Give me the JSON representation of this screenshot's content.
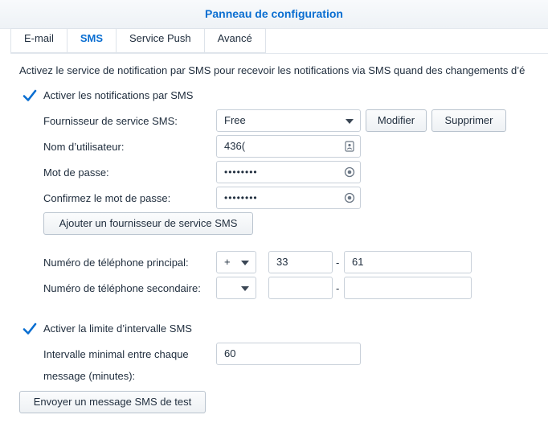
{
  "header": {
    "title": "Panneau de configuration"
  },
  "tabs": [
    {
      "label": "E-mail",
      "active": false
    },
    {
      "label": "SMS",
      "active": true
    },
    {
      "label": "Service Push",
      "active": false
    },
    {
      "label": "Avancé",
      "active": false
    }
  ],
  "description": "Activez le service de notification par SMS pour recevoir les notifications via SMS quand des changements d’é",
  "enable_sms": {
    "label": "Activer les notifications par SMS",
    "checked": true
  },
  "provider": {
    "label": "Fournisseur de service SMS:",
    "value": "Free",
    "modify_label": "Modifier",
    "delete_label": "Supprimer"
  },
  "username": {
    "label": "Nom d’utilisateur:",
    "value": "436("
  },
  "password": {
    "label": "Mot de passe:",
    "value": "••••••••"
  },
  "confirm_password": {
    "label": "Confirmez le mot de passe:",
    "value": "••••••••"
  },
  "add_provider": {
    "label": "Ajouter un fournisseur de service SMS"
  },
  "primary_phone": {
    "label": "Numéro de téléphone principal:",
    "prefix": "+",
    "country_code": "33",
    "separator": "-",
    "number": "61"
  },
  "secondary_phone": {
    "label": "Numéro de téléphone secondaire:",
    "prefix": "",
    "country_code": "",
    "separator": "-",
    "number": ""
  },
  "interval_limit": {
    "label": "Activer la limite d’intervalle SMS",
    "checked": true
  },
  "min_interval": {
    "label_line1": "Intervalle minimal entre chaque",
    "label_line2": "message (minutes):",
    "value": "60"
  },
  "send_test": {
    "label": "Envoyer un message SMS de test"
  },
  "colors": {
    "accent": "#0a6ed1",
    "text": "#1f2d3d",
    "border": "#c8d0d9"
  }
}
